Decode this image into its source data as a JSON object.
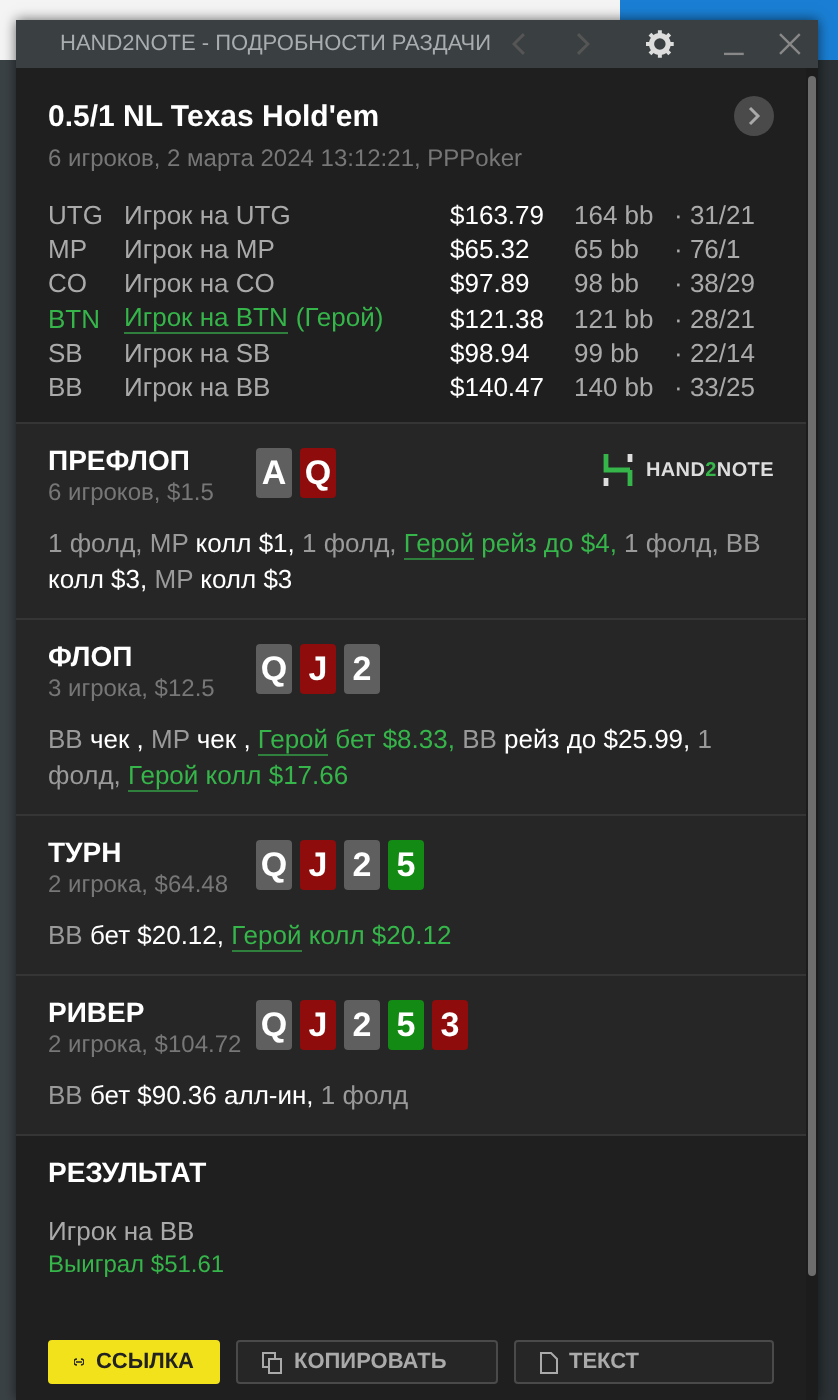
{
  "window": {
    "title": "HAND2NOTE - ПОДРОБНОСТИ РАЗДАЧИ"
  },
  "header": {
    "title": "0.5/1 NL Texas Hold'em",
    "subtitle": "6 игроков, 2 марта 2024 13:12:21, PPPoker"
  },
  "players": [
    {
      "position": "UTG",
      "name": "Игрок на UTG",
      "hero": false,
      "stack": "$163.79",
      "bb": "164 bb",
      "stats": "· 31/21"
    },
    {
      "position": "MP",
      "name": "Игрок на MP",
      "hero": false,
      "stack": "$65.32",
      "bb": "65 bb",
      "stats": "· 76/1"
    },
    {
      "position": "CO",
      "name": "Игрок на CO",
      "hero": false,
      "stack": "$97.89",
      "bb": "98 bb",
      "stats": "· 38/29"
    },
    {
      "position": "BTN",
      "name": "Игрок на BTN",
      "hero": true,
      "hero_tag": "(Герой)",
      "stack": "$121.38",
      "bb": "121 bb",
      "stats": "· 28/21"
    },
    {
      "position": "SB",
      "name": "Игрок на SB",
      "hero": false,
      "stack": "$98.94",
      "bb": "99 bb",
      "stats": "· 22/14"
    },
    {
      "position": "BB",
      "name": "Игрок на BB",
      "hero": false,
      "stack": "$140.47",
      "bb": "140 bb",
      "stats": "· 33/25"
    }
  ],
  "streets": [
    {
      "name": "ПРЕФЛОП",
      "info": "6 игроков, $1.5",
      "cards": [
        {
          "rank": "A",
          "color": "#5f5f5f"
        },
        {
          "rank": "Q",
          "color": "#8e0c0c"
        }
      ],
      "logo": {
        "parts": [
          "HAND",
          "2",
          "NOTE"
        ]
      },
      "actions": [
        {
          "kind": "muted",
          "text": "1 фолд, MP "
        },
        {
          "kind": "action",
          "text": "колл $1,"
        },
        {
          "kind": "muted",
          "text": " 1 фолд, "
        },
        {
          "kind": "hero-name",
          "text": "Герой"
        },
        {
          "kind": "hero",
          "text": " рейз до $4,"
        },
        {
          "kind": "muted",
          "text": " 1 фолд, BB "
        },
        {
          "kind": "action",
          "text": "колл $3,"
        },
        {
          "kind": "muted",
          "text": " MP "
        },
        {
          "kind": "action",
          "text": "колл $3"
        }
      ]
    },
    {
      "name": "ФЛОП",
      "info": "3 игрока, $12.5",
      "cards": [
        {
          "rank": "Q",
          "color": "#5f5f5f"
        },
        {
          "rank": "J",
          "color": "#8e0c0c"
        },
        {
          "rank": "2",
          "color": "#5f5f5f"
        }
      ],
      "actions": [
        {
          "kind": "muted",
          "text": "BB "
        },
        {
          "kind": "action",
          "text": "чек ,"
        },
        {
          "kind": "muted",
          "text": " MP "
        },
        {
          "kind": "action",
          "text": "чек , "
        },
        {
          "kind": "hero-name",
          "text": "Герой"
        },
        {
          "kind": "hero",
          "text": " бет $8.33,"
        },
        {
          "kind": "muted",
          "text": " BB "
        },
        {
          "kind": "action",
          "text": "рейз до $25.99,"
        },
        {
          "kind": "muted",
          "text": " 1 фолд, "
        },
        {
          "kind": "hero-name",
          "text": "Герой"
        },
        {
          "kind": "hero",
          "text": " колл $17.66"
        }
      ]
    },
    {
      "name": "ТУРН",
      "info": "2 игрока, $64.48",
      "cards": [
        {
          "rank": "Q",
          "color": "#5f5f5f"
        },
        {
          "rank": "J",
          "color": "#8e0c0c"
        },
        {
          "rank": "2",
          "color": "#5f5f5f"
        },
        {
          "rank": "5",
          "color": "#138a13"
        }
      ],
      "actions": [
        {
          "kind": "muted",
          "text": "BB "
        },
        {
          "kind": "action",
          "text": "бет $20.12, "
        },
        {
          "kind": "hero-name",
          "text": "Герой"
        },
        {
          "kind": "hero",
          "text": " колл $20.12"
        }
      ]
    },
    {
      "name": "РИВЕР",
      "info": "2 игрока, $104.72",
      "cards": [
        {
          "rank": "Q",
          "color": "#5f5f5f"
        },
        {
          "rank": "J",
          "color": "#8e0c0c"
        },
        {
          "rank": "2",
          "color": "#5f5f5f"
        },
        {
          "rank": "5",
          "color": "#138a13"
        },
        {
          "rank": "3",
          "color": "#8e0c0c"
        }
      ],
      "actions": [
        {
          "kind": "muted",
          "text": "BB "
        },
        {
          "kind": "action",
          "text": "бет $90.36 алл-ин,"
        },
        {
          "kind": "muted",
          "text": " 1 фолд"
        }
      ]
    }
  ],
  "result": {
    "title": "РЕЗУЛЬТАТ",
    "player": "Игрок на BB",
    "outcome": "Выиграл $51.61"
  },
  "buttons": [
    {
      "label": "ССЫЛКА",
      "kind": "primary"
    },
    {
      "label": "КОПИРОВАТЬ",
      "kind": "secondary"
    },
    {
      "label": "ТЕКСТ",
      "kind": "secondary"
    }
  ]
}
